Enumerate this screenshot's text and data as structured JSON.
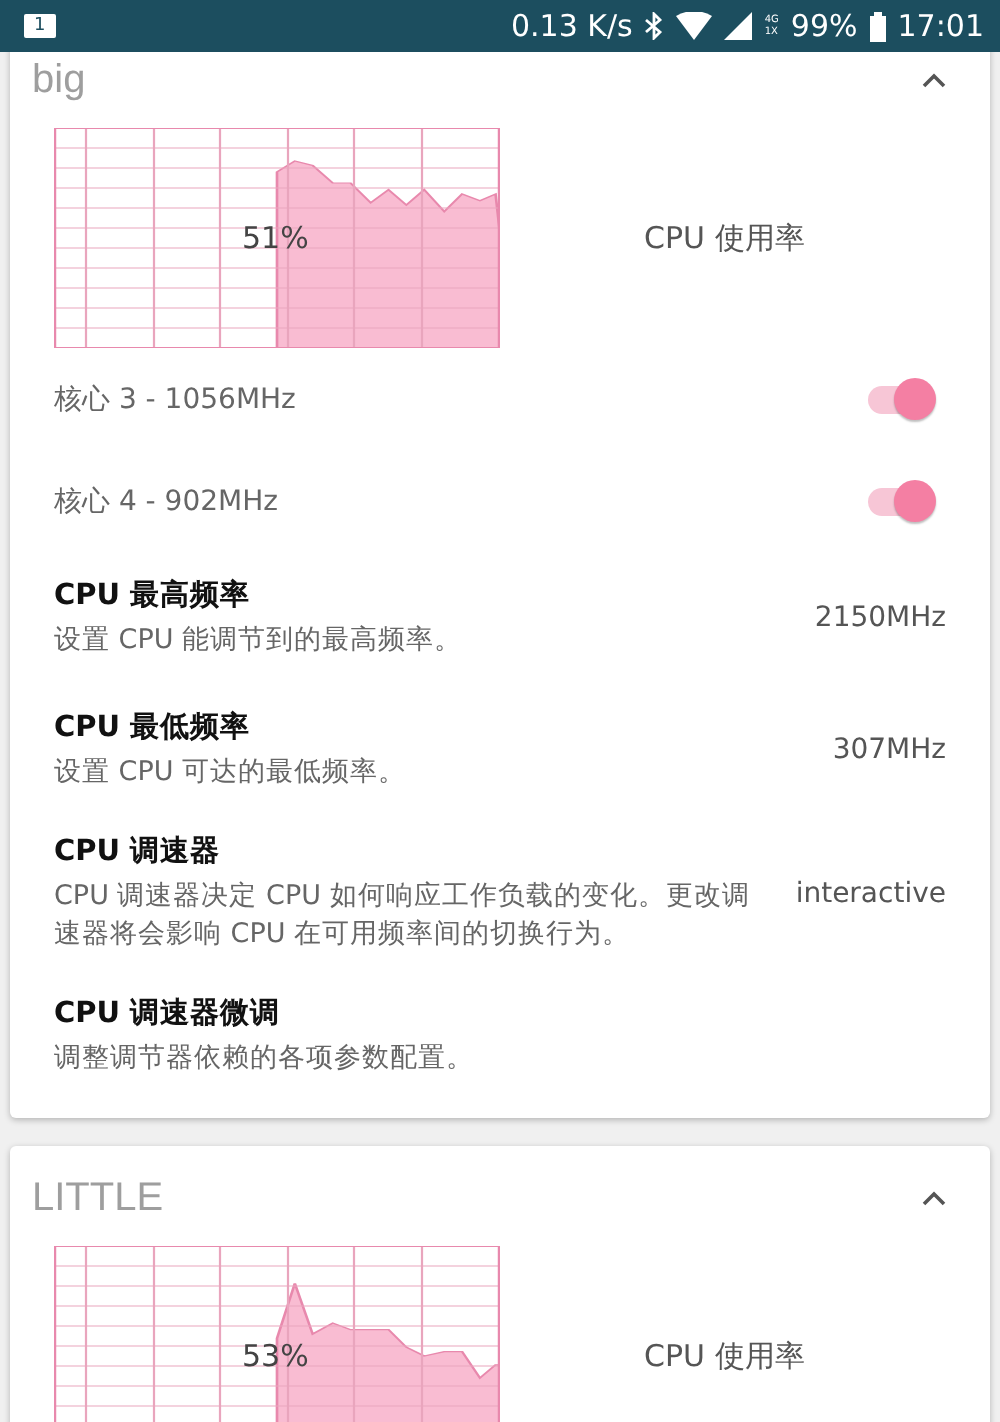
{
  "status_bar": {
    "notification_count": "1",
    "speed": "0.13 K/s",
    "network": [
      "4G",
      "1X"
    ],
    "battery": "99%",
    "time": "17:01"
  },
  "cards": [
    {
      "title": "big",
      "expanded": true,
      "usage": "51%",
      "usage_label": "CPU 使用率",
      "cores": [
        {
          "label": "核心 3 - 1056MHz",
          "on": true
        },
        {
          "label": "核心 4 - 902MHz",
          "on": true
        }
      ],
      "settings": [
        {
          "title": "CPU 最高频率",
          "description": "设置 CPU 能调节到的最高频率。",
          "value": "2150MHz"
        },
        {
          "title": "CPU 最低频率",
          "description": "设置 CPU 可达的最低频率。",
          "value": "307MHz"
        },
        {
          "title": "CPU 调速器",
          "description": "CPU 调速器决定 CPU 如何响应工作负载的变化。更改调速器将会影响 CPU 在可用频率间的切换行为。",
          "value": "interactive"
        },
        {
          "title": "CPU 调速器微调",
          "description": "调整调节器依赖的各项参数配置。"
        }
      ]
    },
    {
      "title": "LITTLE",
      "expanded": true,
      "usage": "53%",
      "usage_label": "CPU 使用率"
    }
  ]
}
